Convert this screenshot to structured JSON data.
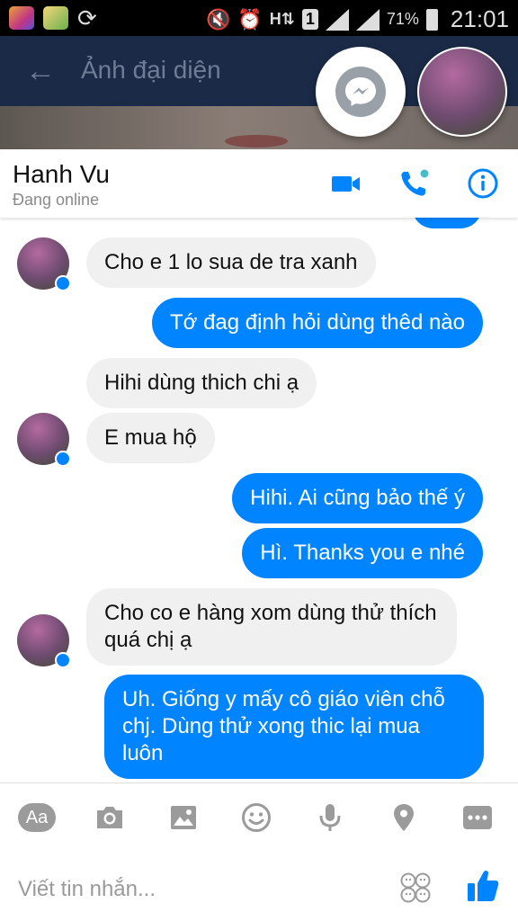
{
  "status_bar": {
    "battery": "71%",
    "time": "21:01",
    "sim": "1"
  },
  "background_screen": {
    "title": "Ảnh đại diện"
  },
  "chat": {
    "contact_name": "Hanh Vu",
    "contact_status": "Đang online",
    "messages": [
      {
        "dir": "in",
        "text": "Cho e 1 lo sua de tra xanh"
      },
      {
        "dir": "out",
        "text": "Tớ đag định hỏi dùng thêd nào"
      },
      {
        "dir": "in",
        "text": "Hihi dùng thich chi ạ"
      },
      {
        "dir": "in",
        "text": "E mua hộ"
      },
      {
        "dir": "out",
        "text": "Hihi. Ai cũng bảo thế ý"
      },
      {
        "dir": "out",
        "text": "Hì. Thanks you e nhé"
      },
      {
        "dir": "in",
        "text": "Cho co e hàng xom dùng thử thích quá chị ạ"
      },
      {
        "dir": "out",
        "text": "Uh. Giống y mấy cô giáo viên chỗ chj. Dùng thử xong thic lại mua luôn"
      }
    ]
  },
  "composer": {
    "aa_label": "Aa",
    "placeholder": "Viết tin nhắn..."
  },
  "colors": {
    "accent": "#0084ff",
    "incoming_bubble": "#f1f0f0",
    "online_dot": "#44bec7"
  }
}
